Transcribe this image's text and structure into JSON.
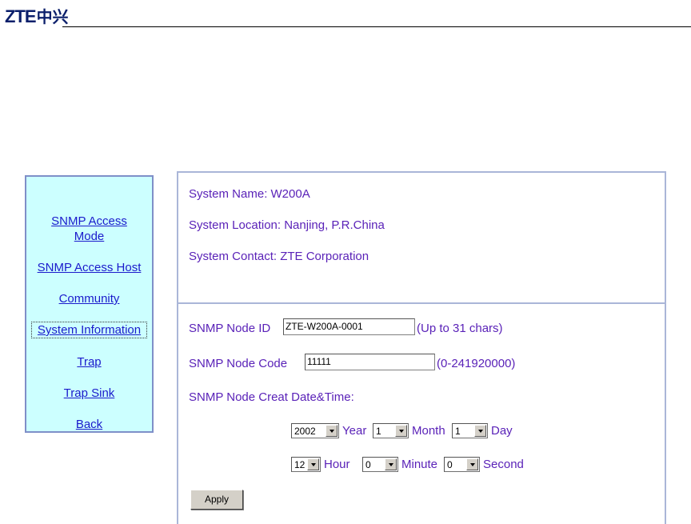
{
  "header": {
    "logo_latin": "ZTE",
    "logo_cn": "中兴"
  },
  "sidebar": {
    "items": [
      {
        "label_line1": "SNMP Access",
        "label_line2": "Mode"
      },
      {
        "label": "SNMP Access Host"
      },
      {
        "label": "Community"
      },
      {
        "label": "System Information",
        "active": true
      },
      {
        "label": "Trap"
      },
      {
        "label": "Trap Sink"
      },
      {
        "label": "Back"
      }
    ]
  },
  "system_info": {
    "name": "System Name: W200A",
    "location": "System Location: Nanjing, P.R.China",
    "contact": "System Contact: ZTE Corporation"
  },
  "form": {
    "node_id_label": "SNMP Node ID",
    "node_id_value": "ZTE-W200A-0001",
    "node_id_hint": "(Up to 31 chars)",
    "node_code_label": "SNMP Node Code",
    "node_code_value": "11111",
    "node_code_hint": "(0-241920000)",
    "date_time_label": "SNMP Node Creat Date&Time:",
    "year_value": "2002",
    "year_label": "Year",
    "month_value": "1",
    "month_label": "Month",
    "day_value": "1",
    "day_label": "Day",
    "hour_value": "12",
    "hour_label": "Hour",
    "minute_value": "0",
    "minute_label": "Minute",
    "second_value": "0",
    "second_label": "Second",
    "apply_label": "Apply"
  }
}
